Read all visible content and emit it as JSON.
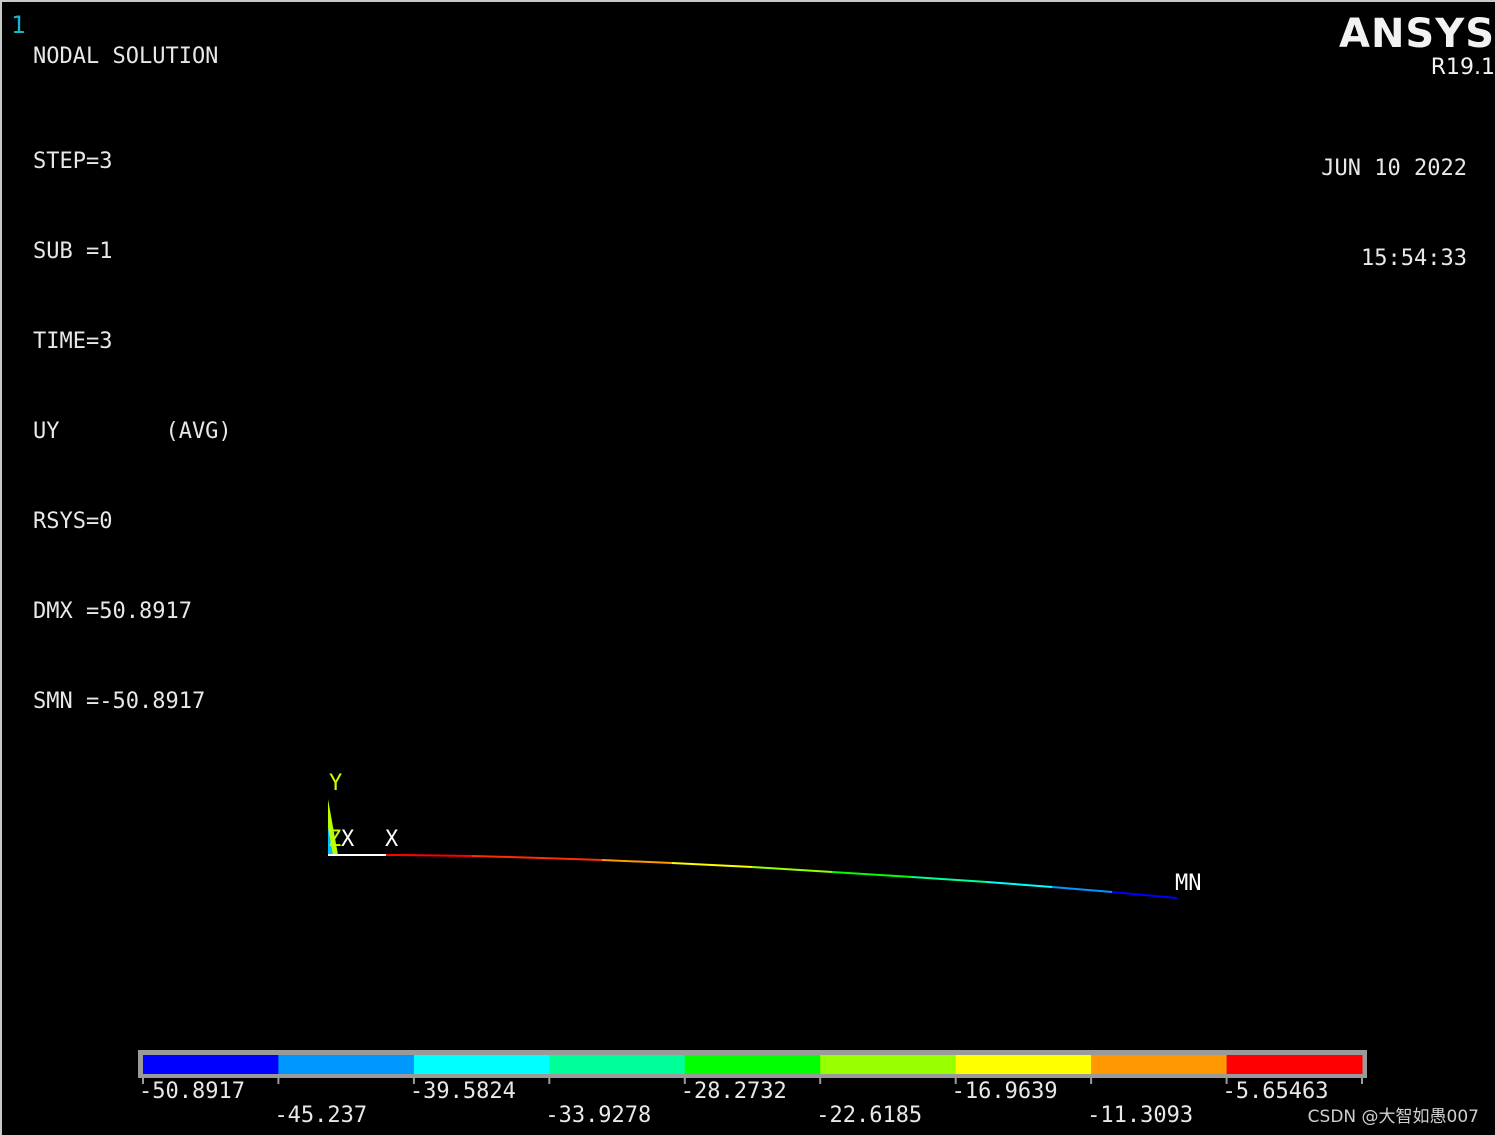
{
  "window": {
    "number": "1"
  },
  "header": {
    "title": "NODAL SOLUTION",
    "lines": {
      "step": "STEP=3",
      "sub": "SUB =1",
      "time": "TIME=3",
      "uy": "UY        (AVG)",
      "rsys": "RSYS=0",
      "dmx": "DMX =50.8917",
      "smn": "SMN =-50.8917"
    }
  },
  "brand": {
    "logo": "ANSYS",
    "version": "R19.1"
  },
  "stamp": {
    "date": "JUN 10 2022",
    "time": "15:54:33"
  },
  "triad": {
    "y": "Y",
    "z": "Z",
    "x": "X"
  },
  "model": {
    "x_label": "X",
    "min_label": "MN"
  },
  "legend": {
    "colors": [
      "#0000ff",
      "#0098ff",
      "#00ffff",
      "#00ff98",
      "#00ff00",
      "#98ff00",
      "#ffff00",
      "#ff9800",
      "#ff0000"
    ],
    "values_top": [
      "-50.8917",
      "-39.5824",
      "-28.2732",
      "-16.9639",
      "-5.65463"
    ],
    "values_bottom": [
      "-45.237",
      "-33.9278",
      "-22.6185",
      "-11.3093"
    ]
  },
  "watermark": "CSDN @大智如愚007"
}
